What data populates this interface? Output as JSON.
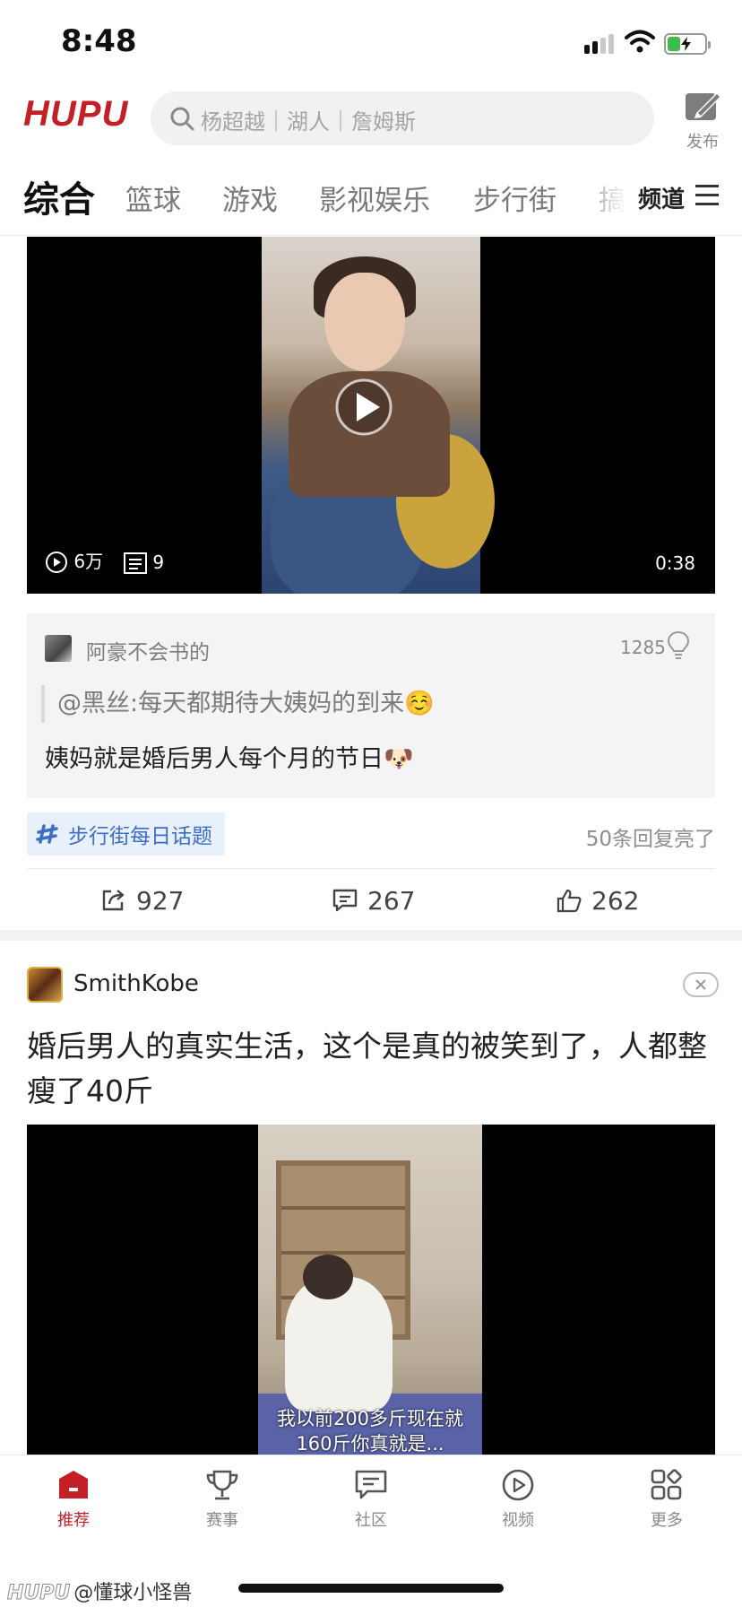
{
  "status_bar": {
    "time": "8:48"
  },
  "header": {
    "logo": "HUPU",
    "search_placeholder": "杨超越｜湖人｜詹姆斯",
    "publish_label": "发布"
  },
  "tabs": {
    "items": [
      "综合",
      "篮球",
      "游戏",
      "影视娱乐",
      "步行街",
      "搞"
    ],
    "active": "综合",
    "channel_label": "频道"
  },
  "post1": {
    "video": {
      "plays": "6万",
      "comments": "9",
      "duration": "0:38"
    },
    "top_comment": {
      "user": "阿豪不会书的",
      "likes": "1285",
      "quote": "@黑丝:每天都期待大姨妈的到来☺️",
      "text": "姨妈就是婚后男人每个月的节日🐶"
    },
    "topic": "步行街每日话题",
    "replies_lit": "50条回复亮了",
    "actions": {
      "share": "927",
      "comment": "267",
      "like": "262"
    }
  },
  "post2": {
    "user": "SmithKobe",
    "title": "婚后男人的真实生活，这个是真的被笑到了，人都整瘦了40斤",
    "video_subtitle_line1": "我以前200多斤现在就",
    "video_subtitle_line2": "160斤你真就是..."
  },
  "bottom_nav": {
    "items": [
      "推荐",
      "赛事",
      "社区",
      "视频",
      "更多"
    ],
    "active": "推荐"
  },
  "watermark": {
    "logo": "HUPU",
    "text": "@懂球小怪兽"
  },
  "colors": {
    "brand_red": "#c21f26",
    "topic_blue": "#3c6ec6"
  }
}
